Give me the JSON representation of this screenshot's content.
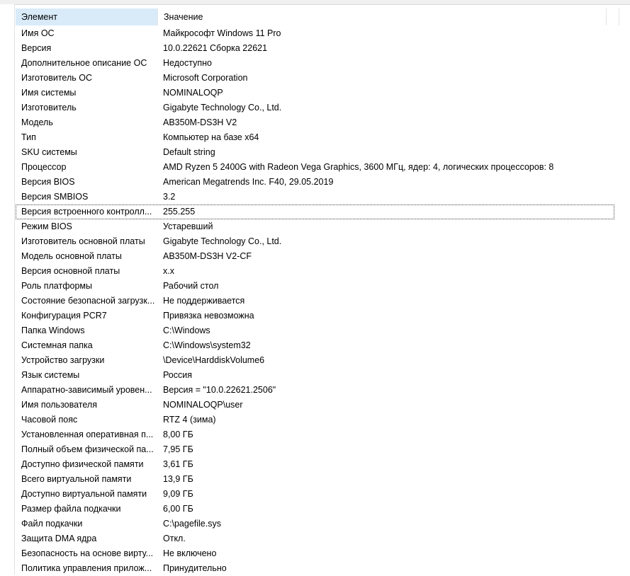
{
  "header": {
    "element_label": "Элемент",
    "value_label": "Значение"
  },
  "rows": [
    {
      "name": "Имя ОС",
      "value": "Майкрософт Windows 11 Pro"
    },
    {
      "name": "Версия",
      "value": "10.0.22621 Сборка 22621"
    },
    {
      "name": "Дополнительное описание ОС",
      "value": "Недоступно"
    },
    {
      "name": "Изготовитель ОС",
      "value": "Microsoft Corporation"
    },
    {
      "name": "Имя системы",
      "value": "NOMINALOQP"
    },
    {
      "name": "Изготовитель",
      "value": "Gigabyte Technology Co., Ltd."
    },
    {
      "name": "Модель",
      "value": "AB350M-DS3H V2"
    },
    {
      "name": "Тип",
      "value": "Компьютер на базе x64"
    },
    {
      "name": "SKU системы",
      "value": "Default string"
    },
    {
      "name": "Процессор",
      "value": "AMD Ryzen 5 2400G with Radeon Vega Graphics, 3600 МГц, ядер: 4, логических процессоров: 8"
    },
    {
      "name": "Версия BIOS",
      "value": "American Megatrends Inc. F40, 29.05.2019"
    },
    {
      "name": "Версия SMBIOS",
      "value": "3.2"
    },
    {
      "name": "Версия встроенного контролл...",
      "value": "255.255"
    },
    {
      "name": "Режим BIOS",
      "value": "Устаревший"
    },
    {
      "name": "Изготовитель основной платы",
      "value": "Gigabyte Technology Co., Ltd."
    },
    {
      "name": "Модель основной платы",
      "value": "AB350M-DS3H V2-CF"
    },
    {
      "name": "Версия основной платы",
      "value": "x.x"
    },
    {
      "name": "Роль платформы",
      "value": "Рабочий стол"
    },
    {
      "name": "Состояние безопасной загрузк...",
      "value": "Не поддерживается"
    },
    {
      "name": "Конфигурация PCR7",
      "value": "Привязка невозможна"
    },
    {
      "name": "Папка Windows",
      "value": "C:\\Windows"
    },
    {
      "name": "Системная папка",
      "value": "C:\\Windows\\system32"
    },
    {
      "name": "Устройство загрузки",
      "value": "\\Device\\HarddiskVolume6"
    },
    {
      "name": "Язык системы",
      "value": "Россия"
    },
    {
      "name": "Аппаратно-зависимый уровен...",
      "value": "Версия = \"10.0.22621.2506\""
    },
    {
      "name": "Имя пользователя",
      "value": "NOMINALOQP\\user"
    },
    {
      "name": "Часовой пояс",
      "value": "RTZ 4 (зима)"
    },
    {
      "name": "Установленная оперативная п...",
      "value": "8,00 ГБ"
    },
    {
      "name": "Полный объем физической па...",
      "value": "7,95 ГБ"
    },
    {
      "name": "Доступно физической памяти",
      "value": "3,61 ГБ"
    },
    {
      "name": "Всего виртуальной памяти",
      "value": "13,9 ГБ"
    },
    {
      "name": "Доступно виртуальной памяти",
      "value": "9,09 ГБ"
    },
    {
      "name": "Размер файла подкачки",
      "value": "6,00 ГБ"
    },
    {
      "name": "Файл подкачки",
      "value": "C:\\pagefile.sys"
    },
    {
      "name": "Защита DMA ядра",
      "value": "Откл."
    },
    {
      "name": "Безопасность на основе вирту...",
      "value": "Не включено"
    },
    {
      "name": "Политика управления прилож...",
      "value": "Принудительно"
    }
  ],
  "selected_row": "Версия встроенного контролл..."
}
